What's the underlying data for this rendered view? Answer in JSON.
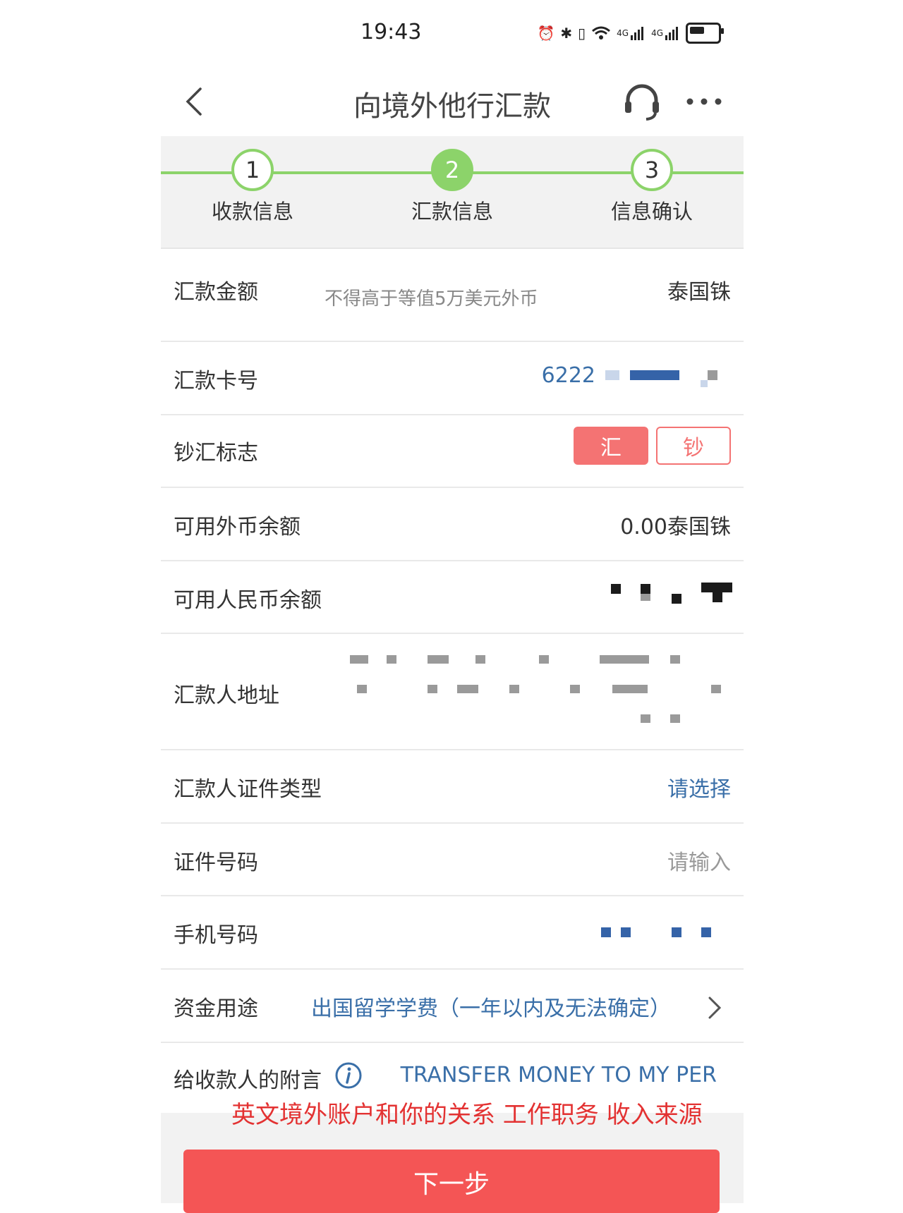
{
  "status_bar": {
    "time": "19:43",
    "icons": [
      "alarm-icon",
      "bluetooth-icon",
      "vibrate-icon",
      "wifi-icon",
      "signal-4g-icon",
      "signal-4g-icon",
      "battery-icon"
    ],
    "net1": "4G",
    "net2": "4G"
  },
  "nav": {
    "title": "向境外他行汇款",
    "back_icon": "back-chevron-icon",
    "service_icon": "headset-icon",
    "more_icon": "more-dots-icon"
  },
  "steps": [
    {
      "number": "1",
      "label": "收款信息",
      "active": false
    },
    {
      "number": "2",
      "label": "汇款信息",
      "active": true
    },
    {
      "number": "3",
      "label": "信息确认",
      "active": false
    }
  ],
  "form": {
    "amount": {
      "label": "汇款金额",
      "placeholder": "不得高于等值5万美元外币",
      "currency": "泰国铢"
    },
    "card_no": {
      "label": "汇款卡号",
      "value": "6222"
    },
    "cash_flag": {
      "label": "钞汇标志",
      "option_remit": "汇",
      "option_cash": "钞",
      "selected": "汇"
    },
    "fx_balance": {
      "label": "可用外币余额",
      "value": "0.00泰国铢"
    },
    "rmb_balance": {
      "label": "可用人民币余额"
    },
    "address": {
      "label": "汇款人地址"
    },
    "id_type": {
      "label": "汇款人证件类型",
      "value": "请选择"
    },
    "id_no": {
      "label": "证件号码",
      "placeholder": "请输入"
    },
    "phone": {
      "label": "手机号码"
    },
    "purpose": {
      "label": "资金用途",
      "value": "出国留学学费（一年以内及无法确定）"
    },
    "remark": {
      "label": "给收款人的附言",
      "value": "TRANSFER MONEY TO MY PER"
    }
  },
  "annotation": "英文境外账户和你的关系 工作职务 收入来源",
  "next_button": "下一步",
  "colors": {
    "step_green": "#8cd36a",
    "accent_red": "#f47373",
    "button_red": "#f45555",
    "link_blue": "#3a6fa8",
    "annotation_red": "#e33232"
  }
}
